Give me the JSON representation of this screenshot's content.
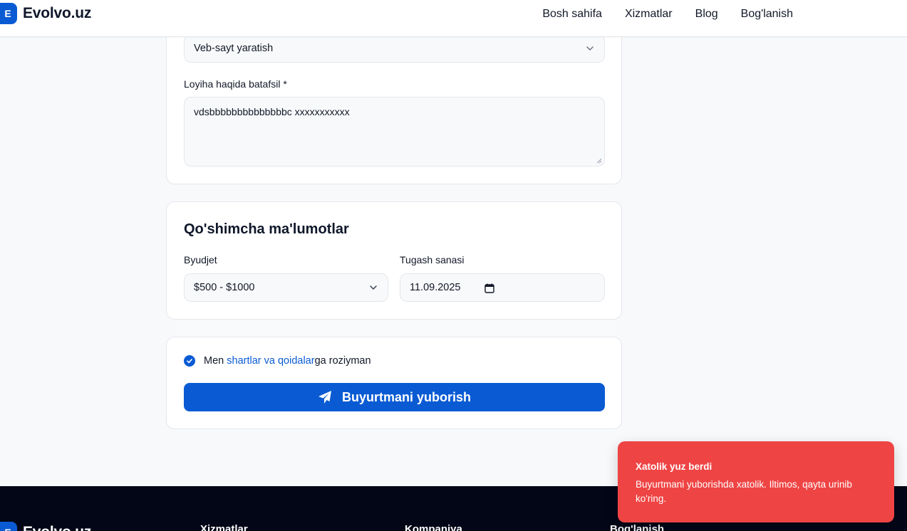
{
  "header": {
    "logo_letter": "E",
    "logo_text": "Evolvo.uz",
    "nav": [
      "Bosh sahifa",
      "Xizmatlar",
      "Blog",
      "Bog'lanish"
    ]
  },
  "project_card": {
    "service_select_value": "Veb-sayt yaratish",
    "details_label": "Loyiha haqida batafsil *",
    "details_value": "vdsbbbbbbbbbbbbbbc xxxxxxxxxxx"
  },
  "extra_card": {
    "title": "Qo'shimcha ma'lumotlar",
    "budget_label": "Byudjet",
    "budget_value": "$500 - $1000",
    "deadline_label": "Tugash sanasi",
    "deadline_value": "11.09.2025"
  },
  "submit_card": {
    "agree_prefix": "Men ",
    "agree_link": "shartlar va qoidalar",
    "agree_suffix": "ga roziyman",
    "agree_checked": true,
    "submit_label": "Buyurtmani yuborish"
  },
  "footer": {
    "logo_text": "Evolvo.uz",
    "columns": [
      "Xizmatlar",
      "Kompaniya",
      "Bog'lanish"
    ]
  },
  "toast": {
    "title": "Xatolik yuz berdi",
    "message": "Buyurtmani yuborishda xatolik. Iltimos, qayta urinib ko'ring.",
    "color": "#ef4444"
  },
  "colors": {
    "primary": "#0a5bd3",
    "footer_bg": "#020617",
    "page_bg": "#f8f9fb"
  },
  "icons": {
    "select_chevron": "chevron-down-icon",
    "calendar": "calendar-icon",
    "checkbox": "check-icon",
    "submit": "send-icon"
  }
}
